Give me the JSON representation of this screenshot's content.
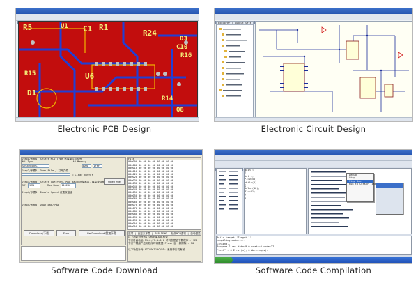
{
  "captions": {
    "pcb": "Electronic PCB Design",
    "circuit": "Electronic Circuit Design",
    "download": "Software Code Download",
    "compile": "Software Code Compilation"
  },
  "pcb": {
    "labels": [
      "R5",
      "U1",
      "C1",
      "R1",
      "R24",
      "D3",
      "C10",
      "R16",
      "U6",
      "R15",
      "D1",
      "R14",
      "Q8"
    ],
    "colors": {
      "board": "#c20d0d",
      "trace": "#1f3fd6",
      "silkscreen": "#f4f07a",
      "pad": "#c0c0c0"
    }
  },
  "circuit": {
    "tabs": [
      "Explorer",
      "Output Sets"
    ]
  },
  "download": {
    "mcu_type_label": "MCU Type",
    "ap_memory_label": "AP Memory",
    "mcu_value": "STC89C52RC",
    "mem_start": "0000",
    "mem_end": "1FFF",
    "step1": "Step1/步骤1: Select MCU Type 选择单片机型号",
    "step2": "Step2/步骤2: Open File / 打开文件",
    "step3": "Step3/步骤3: Select COM Port, Max Baud(选择串口，最高波特率)",
    "com_label": "COM",
    "com_value": "COM1",
    "max_baud_label": "Max Baud",
    "max_baud_value": "115200",
    "step4": "Step4/步骤4: Double Speed 设置双倍速",
    "step5": "Step5/步骤5: Download/下载",
    "open_file_button": "Open File",
    "download_button": "Download/下载",
    "stop_button": "Stop",
    "redownload_button": "Re-Download/重复下载",
    "clear_buffer_label": "Clear Buffer",
    "hex_header": "File",
    "hex_rows": [
      "000000 00 00 00 00 00 00 00 00",
      "000008 00 00 00 00 00 00 00 00",
      "000010 00 00 00 00 00 00 00 00",
      "000018 00 00 00 00 00 00 00 00",
      "000020 00 00 00 00 00 00 00 00",
      "000028 00 00 00 00 00 00 00 00",
      "000030 00 00 00 00 00 00 00 00",
      "000038 00 00 00 00 00 00 00 00",
      "000040 00 00 00 00 00 00 00 00",
      "000048 00 00 00 00 00 00 00 00",
      "000050 00 00 00 00 00 00 00 00",
      "000058 00 00 00 00 00 00 00 00",
      "000060 00 00 00 00 00 00 00 00",
      "000068 00 00 00 00 00 00 00 00",
      "000070 00 00 00 00 00 00 00 00",
      "000078 00 00 00 00 00 00 00 00",
      "000080 00 00 00 00 00 00 00 00",
      "000088 00 00 00 00 00 00 00 00",
      "000090 00 00 00 00 00 00 00 00",
      "000098 00 00 00 00 00 00 00 00",
      "0000A0 00 00 00 00 00 00 00 00",
      "0000A8 00 00 00 00 00 00 00 00"
    ],
    "bottom_tabs": "选项 | 自定义下载 | ISP DEMO | 检测MCU选项 | 自动增量 | 脱机下载",
    "bottom_lines": [
      "以下功能对所有STC系列单片机有效",
      "下次冷启动后 P1.0,P1.1=0,0 才判断是否下载程序 ✓ YES",
      "下次下载用户应用程序时将数据 Flash 区一并擦除 ✓ NO",
      "以下功能针对 STC89C51RC/RD+ 系列单片机有效"
    ]
  },
  "compile": {
    "menu_items": [
      "Debug",
      "Step",
      "Step Over",
      "Run to Cursor line"
    ],
    "code_lines": [
      "main()",
      "{",
      "  int i;",
      "  P1=0x55;",
      "  while(1)",
      "  {",
      "   delay(10);",
      "   P1=~P1;",
      "  }",
      "}"
    ],
    "output_lines": [
      "Build target 'Target 1'",
      "compiling main.c...",
      "linking...",
      "Program Size: data=9.0 xdata=0 code=37",
      "\"test\" - 0 Error(s), 0 Warning(s)."
    ]
  }
}
